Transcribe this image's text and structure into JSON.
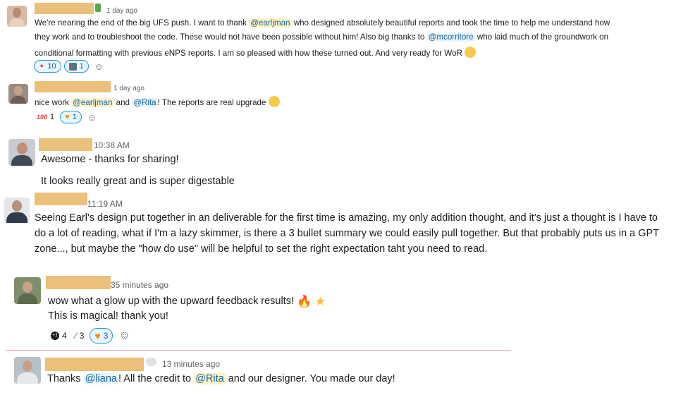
{
  "messages": [
    {
      "time": "1 day ago",
      "badge_icon": "status-emoji-icon",
      "lines": [
        {
          "parts": [
            {
              "t": "We're nearing the end of the big UFS push. I want to thank "
            },
            {
              "m": "@earljman"
            },
            {
              "t": " who designed absolutely beautiful reports and took the time to help me understand how"
            }
          ]
        },
        {
          "parts": [
            {
              "t": "they work and to troubleshoot the code. These would not have been possible without him! Also big thanks to "
            },
            {
              "m": "@mcorritore",
              "blue": true
            },
            {
              "t": " who laid much of the groundwork on"
            }
          ]
        },
        {
          "parts": [
            {
              "t": "conditional formatting with previous eNPS reports. I am so pleased with how these turned out. And very ready for WoR "
            }
          ]
        }
      ],
      "reactions": [
        {
          "emoji": "tada-icon",
          "count": "10",
          "selected": true
        },
        {
          "emoji": "person-icon",
          "count": "1",
          "selected": true
        }
      ]
    },
    {
      "time": "1 day ago",
      "lines": [
        {
          "parts": [
            {
              "t": "nice work "
            },
            {
              "m": "@earljman"
            },
            {
              "t": " and "
            },
            {
              "m": "@Rita",
              "blue": true
            },
            {
              "t": "!  The reports are real upgrade "
            }
          ]
        }
      ],
      "reactions": [
        {
          "emoji": "100-icon",
          "count": "1",
          "selected": false
        },
        {
          "emoji": "orange-heart-icon",
          "count": "1",
          "selected": true
        }
      ]
    },
    {
      "time": "10:38 AM",
      "lines": [
        {
          "parts": [
            {
              "t": "Awesome - thanks for sharing!"
            }
          ]
        },
        {
          "parts": [
            {
              "t": "It looks really great and is super digestable"
            }
          ]
        }
      ]
    },
    {
      "time": "11:19 AM",
      "lines": [
        {
          "parts": [
            {
              "t": "Seeing Earl's design put together in an deliverable for the first time is amazing, my only addition thought, and it's just a thought  is I have to"
            }
          ]
        },
        {
          "parts": [
            {
              "t": "do a lot of reading, what if I'm a lazy skimmer, is there a 3 bullet summary we could easily pull together. But that probably puts us in a GPT"
            }
          ]
        },
        {
          "parts": [
            {
              "t": "zone..., but maybe the \"how do use\" will be helpful to set the right expectation taht you need to read."
            }
          ]
        }
      ]
    },
    {
      "time": "35 minutes ago",
      "lines": [
        {
          "parts": [
            {
              "t": "wow what a glow up with the upward feedback results! "
            }
          ]
        },
        {
          "parts": [
            {
              "t": "This is magical! thank you!"
            }
          ]
        }
      ],
      "reactions": [
        {
          "emoji": "plus-one-icon",
          "count": "4",
          "selected": false
        },
        {
          "emoji": "magic-wand-icon",
          "count": "3",
          "selected": false
        },
        {
          "emoji": "orange-heart-icon",
          "count": "3",
          "selected": true
        }
      ]
    },
    {
      "time": "13 minutes ago",
      "badge_icon": "speech-bubble-icon",
      "lines": [
        {
          "parts": [
            {
              "t": "Thanks "
            },
            {
              "m": "@liana",
              "blue": true
            },
            {
              "t": "!  All the credit to "
            },
            {
              "m": "@Rita"
            },
            {
              "t": " and our designer.  You made our day!"
            }
          ]
        }
      ]
    }
  ],
  "colors": {
    "name_block": "#eac07a",
    "mention_bg": "#fdf1c6",
    "mention_text": "#1264a3",
    "selected_reaction_border": "#1d9bd1",
    "new_messages_divider": "#e3a1a8"
  }
}
